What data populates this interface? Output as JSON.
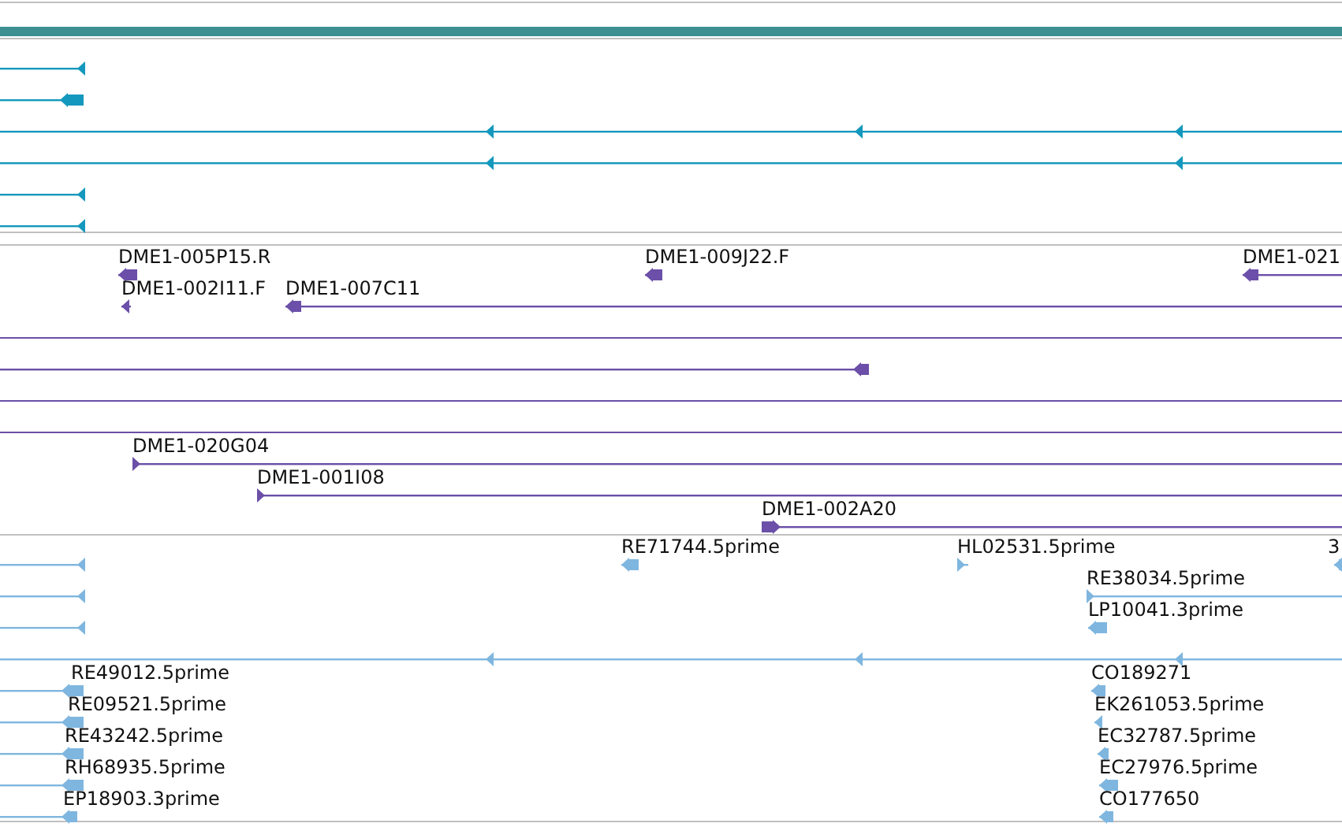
{
  "overview_bar": {
    "color": "#3d8f91"
  },
  "tracks": [
    {
      "color": "#1598bd",
      "rows": [
        {
          "features": [
            {
              "kind": "arrow",
              "reverse": true
            }
          ]
        },
        {
          "features": [
            {
              "kind": "arrow",
              "reverse": true
            }
          ]
        },
        {
          "features": [
            {
              "kind": "arrow",
              "reverse": true
            }
          ]
        },
        {
          "features": [
            {
              "kind": "arrow",
              "reverse": true
            }
          ]
        },
        {
          "features": [
            {
              "kind": "arrow",
              "reverse": true
            }
          ]
        },
        {
          "features": [
            {
              "kind": "arrow",
              "reverse": true
            }
          ]
        }
      ]
    },
    {
      "color": "#6b4fa8",
      "rows": [
        {
          "features": [
            {
              "kind": "arrow",
              "label": "DME1-005P15.R",
              "reverse": true
            },
            {
              "kind": "arrow",
              "label": "DME1-009J22.F",
              "reverse": true
            },
            {
              "kind": "arrow",
              "label": "DME1-021",
              "reverse": true
            }
          ]
        },
        {
          "features": [
            {
              "kind": "arrow",
              "label": "DME1-002I11.F",
              "reverse": true
            },
            {
              "kind": "arrow",
              "label": "DME1-007C11",
              "reverse": true
            }
          ]
        },
        {
          "features": [
            {
              "kind": "line"
            }
          ]
        },
        {
          "features": [
            {
              "kind": "arrow",
              "reverse": true
            }
          ]
        },
        {
          "features": [
            {
              "kind": "line"
            }
          ]
        },
        {
          "features": [
            {
              "kind": "line"
            }
          ]
        },
        {
          "features": [
            {
              "kind": "arrow",
              "label": "DME1-020G04",
              "reverse": false
            }
          ]
        },
        {
          "features": [
            {
              "kind": "arrow",
              "label": "DME1-001I08",
              "reverse": false
            }
          ]
        },
        {
          "features": [
            {
              "kind": "arrow",
              "label": "DME1-002A20",
              "reverse": false
            }
          ]
        }
      ]
    },
    {
      "color": "#7fb6df",
      "rows": [
        {
          "features": [
            {
              "kind": "arrow",
              "reverse": true
            },
            {
              "kind": "arrow",
              "label": "RE71744.5prime",
              "reverse": true
            },
            {
              "kind": "arrow",
              "label": "HL02531.5prime",
              "reverse": false
            },
            {
              "kind": "arrow",
              "label": "3",
              "reverse": true
            }
          ]
        },
        {
          "features": [
            {
              "kind": "arrow",
              "reverse": true
            },
            {
              "kind": "arrow",
              "label": "RE38034.5prime",
              "reverse": false
            }
          ]
        },
        {
          "features": [
            {
              "kind": "arrow",
              "reverse": true
            },
            {
              "kind": "arrow",
              "label": "LP10041.3prime",
              "reverse": true
            }
          ]
        },
        {
          "features": [
            {
              "kind": "arrow",
              "reverse": true
            }
          ]
        },
        {
          "features": [
            {
              "kind": "arrow",
              "label": "RE49012.5prime",
              "reverse": true
            },
            {
              "kind": "arrow",
              "label": "CO189271",
              "reverse": true
            }
          ]
        },
        {
          "features": [
            {
              "kind": "arrow",
              "label": "RE09521.5prime",
              "reverse": true
            },
            {
              "kind": "arrow",
              "label": "EK261053.5prime",
              "reverse": true
            }
          ]
        },
        {
          "features": [
            {
              "kind": "arrow",
              "label": "RE43242.5prime",
              "reverse": true
            },
            {
              "kind": "arrow",
              "label": "EC32787.5prime",
              "reverse": true
            }
          ]
        },
        {
          "features": [
            {
              "kind": "arrow",
              "label": "RH68935.5prime",
              "reverse": true
            },
            {
              "kind": "arrow",
              "label": "EC27976.5prime",
              "reverse": true
            }
          ]
        },
        {
          "features": [
            {
              "kind": "arrow",
              "label": "EP18903.3prime",
              "reverse": true
            },
            {
              "kind": "arrow",
              "label": "CO177650",
              "reverse": true
            }
          ]
        }
      ]
    }
  ]
}
